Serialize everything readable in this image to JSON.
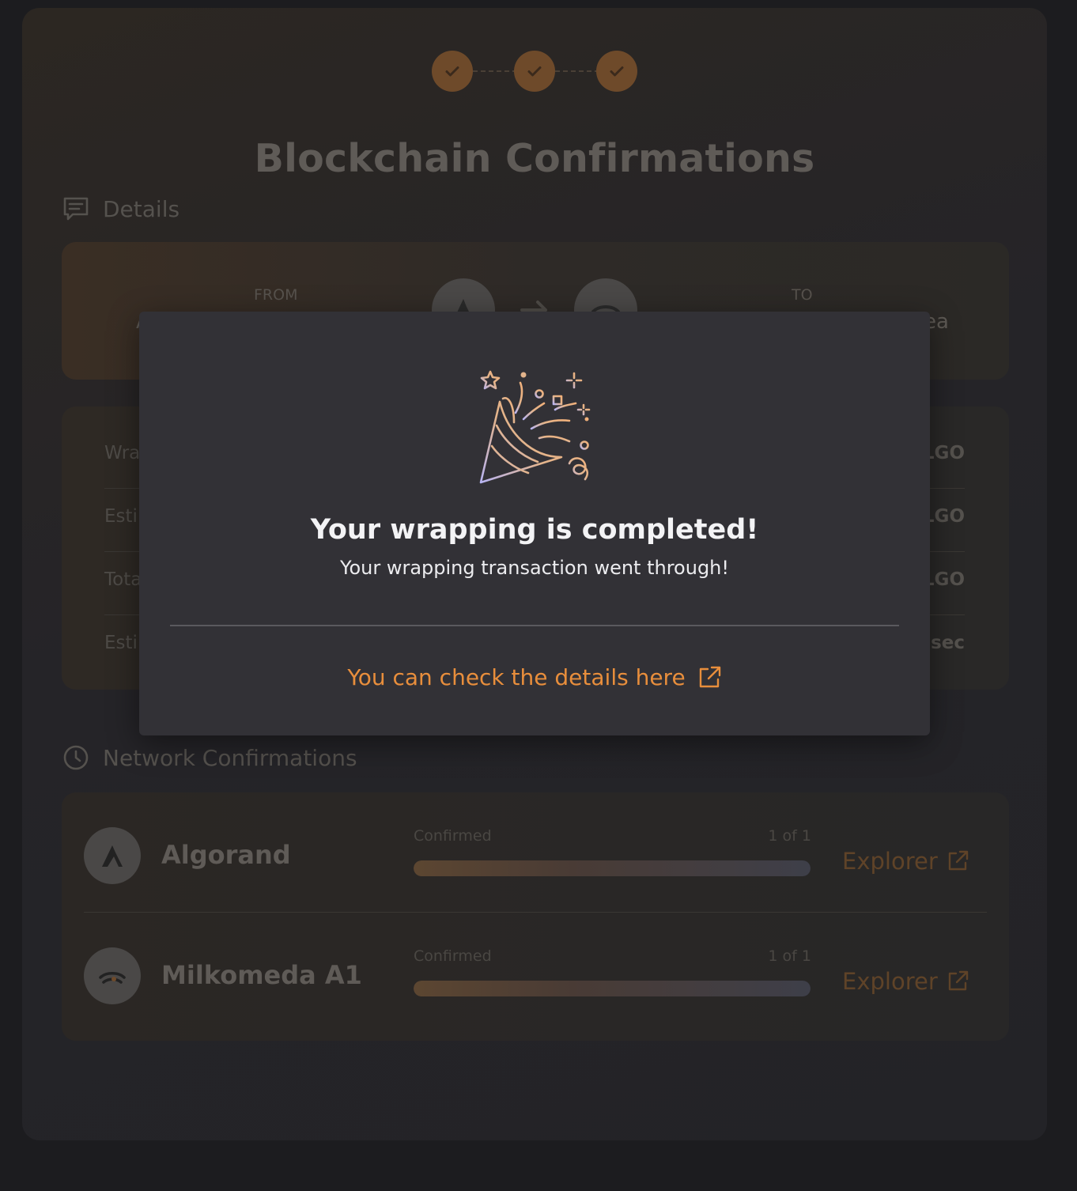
{
  "page": {
    "title": "Blockchain Confirmations",
    "steps": [
      "step-1",
      "step-2",
      "step-3"
    ]
  },
  "details": {
    "heading": "Details",
    "icon": "message-square-icon",
    "from_label": "FROM",
    "to_label": "TO",
    "from_value_visible": "A",
    "to_value_visible": "ea",
    "rows": [
      {
        "label_visible": "Wra",
        "value_visible": "LGO"
      },
      {
        "label_visible": "Esti",
        "value_visible": "LGO"
      },
      {
        "label_visible": "Tota",
        "value_visible": "LGO"
      },
      {
        "label_visible": "Esti",
        "value_visible": "sec"
      }
    ]
  },
  "network": {
    "heading": "Network Confirmations",
    "icon": "clock-icon",
    "chains": [
      {
        "name": "Algorand",
        "status": "Confirmed",
        "count": "1 of 1",
        "progress": 1.0,
        "explorer": "Explorer"
      },
      {
        "name": "Milkomeda A1",
        "status": "Confirmed",
        "count": "1 of 1",
        "progress": 1.0,
        "explorer": "Explorer"
      }
    ]
  },
  "modal": {
    "icon": "party-popper-icon",
    "title": "Your wrapping is completed!",
    "subtitle": "Your wrapping transaction went through!",
    "link_text": "You can check the details here",
    "link_icon": "external-link-icon"
  },
  "colors": {
    "accent": "#e88e3c",
    "modal_bg": "#323136",
    "page_bg": "#1c1c1f"
  }
}
